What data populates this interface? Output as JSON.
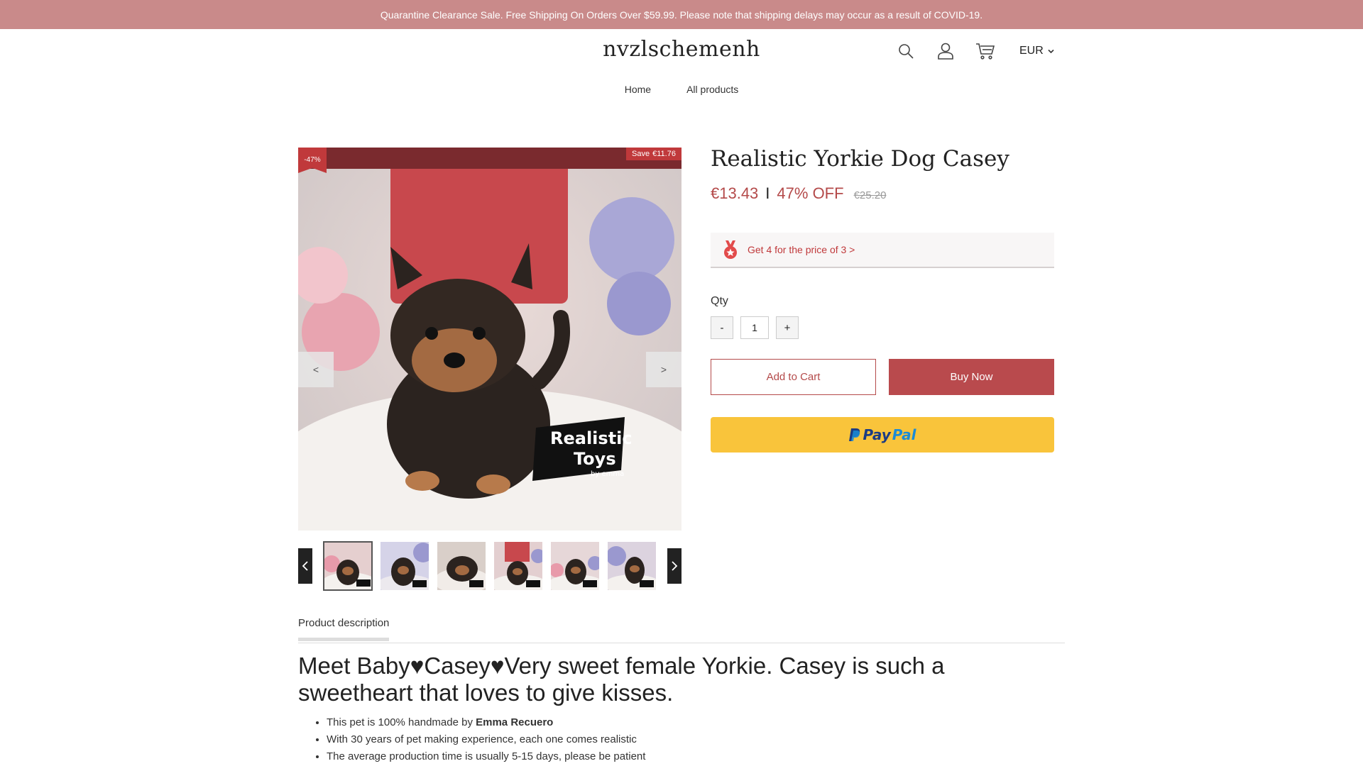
{
  "promo": {
    "text": "Quarantine Clearance Sale. Free Shipping On Orders Over $59.99. Please note that shipping delays may occur as a result of COVID-19."
  },
  "header": {
    "logo": "nvzlschemenh",
    "currency": "EUR"
  },
  "nav": {
    "items": [
      "Home",
      "All products"
    ]
  },
  "gallery": {
    "discount_badge": "-47%",
    "save_label": "Save",
    "save_amount": "€11.76",
    "prev_label": "<",
    "next_label": ">",
    "main_overlay_line1": "Realistic",
    "main_overlay_line2": "Toys",
    "main_overlay_line3": "by emma",
    "thumbnail_count": 6
  },
  "product": {
    "title": "Realistic Yorkie Dog Casey",
    "price": "€13.43",
    "separator": "I",
    "off_label": "47% OFF",
    "compare_price": "€25.20",
    "offer_text": "Get 4 for the price of 3 >",
    "qty_label": "Qty",
    "qty_minus": "-",
    "qty_value": "1",
    "qty_plus": "+",
    "add_to_cart": "Add to Cart",
    "buy_now": "Buy Now",
    "paypal_p1": "Pay",
    "paypal_p2": "Pal"
  },
  "description": {
    "tab_label": "Product description",
    "headline_part1": "Meet Baby",
    "headline_part2": "Casey",
    "headline_part3": "Very sweet female Yorkie. Casey is such a sweetheart that loves to give kisses.",
    "bullets": [
      {
        "text": "This pet is 100% handmade by ",
        "bold": "Emma Recuero"
      },
      {
        "text": "With 30 years of pet making experience, each one comes realistic"
      },
      {
        "text": "The average production time is usually 5-15 days, please be patient"
      }
    ]
  },
  "colors": {
    "accent": "#b94a4d",
    "promo_bg": "#c98a8a",
    "paypal_yellow": "#f9c43b"
  }
}
